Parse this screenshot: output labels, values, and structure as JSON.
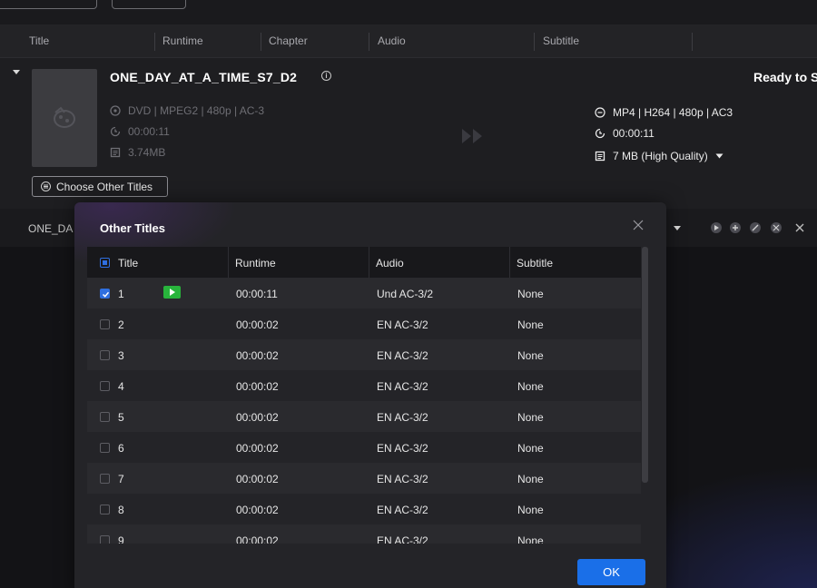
{
  "header_columns": [
    "Title",
    "Runtime",
    "Chapter",
    "Audio",
    "Subtitle"
  ],
  "movie": {
    "title": "ONE_DAY_AT_A_TIME_S7_D2",
    "status": "Ready to S",
    "source": {
      "format": "DVD | MPEG2 | 480p | AC-3",
      "duration": "00:00:11",
      "size": "3.74MB"
    },
    "output": {
      "format": "MP4 | H264 | 480p | AC3",
      "duration": "00:00:11",
      "size": "7 MB (High Quality)"
    },
    "choose_button": "Choose Other Titles"
  },
  "row2_title": "ONE_DA",
  "dialog": {
    "title": "Other Titles",
    "ok_label": "OK",
    "columns": [
      "Title",
      "Runtime",
      "Audio",
      "Subtitle"
    ],
    "rows": [
      {
        "title": "1",
        "runtime": "00:00:11",
        "audio": "Und  AC-3/2",
        "subtitle": "None",
        "checked": true,
        "playing": true
      },
      {
        "title": "2",
        "runtime": "00:00:02",
        "audio": "EN  AC-3/2",
        "subtitle": "None",
        "checked": false,
        "playing": false
      },
      {
        "title": "3",
        "runtime": "00:00:02",
        "audio": "EN  AC-3/2",
        "subtitle": "None",
        "checked": false,
        "playing": false
      },
      {
        "title": "4",
        "runtime": "00:00:02",
        "audio": "EN  AC-3/2",
        "subtitle": "None",
        "checked": false,
        "playing": false
      },
      {
        "title": "5",
        "runtime": "00:00:02",
        "audio": "EN  AC-3/2",
        "subtitle": "None",
        "checked": false,
        "playing": false
      },
      {
        "title": "6",
        "runtime": "00:00:02",
        "audio": "EN  AC-3/2",
        "subtitle": "None",
        "checked": false,
        "playing": false
      },
      {
        "title": "7",
        "runtime": "00:00:02",
        "audio": "EN  AC-3/2",
        "subtitle": "None",
        "checked": false,
        "playing": false
      },
      {
        "title": "8",
        "runtime": "00:00:02",
        "audio": "EN  AC-3/2",
        "subtitle": "None",
        "checked": false,
        "playing": false
      },
      {
        "title": "9",
        "runtime": "00:00:02",
        "audio": "EN  AC-3/2",
        "subtitle": "None",
        "checked": false,
        "playing": false
      }
    ]
  },
  "colors": {
    "accent": "#1a6fe8",
    "play_badge": "#28b43c",
    "background": "#1c1c1f"
  }
}
